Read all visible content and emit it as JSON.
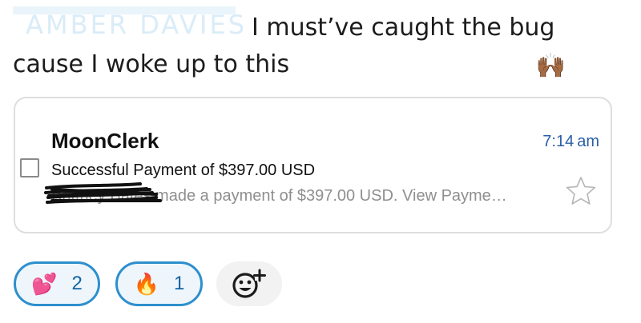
{
  "message": {
    "author_name": "AMBER DAVIES",
    "text": "I must’ve caught the bug cause I woke up to this",
    "emoji": "🙌🏾"
  },
  "email": {
    "sender": "MoonClerk",
    "time": "7:14 am",
    "subject": "Successful Payment of $397.00 USD",
    "preview": "Brittney Bates made a payment of $397.00 USD. View Payme…",
    "starred": false
  },
  "reactions": [
    {
      "emoji": "💕",
      "icon": "two-hearts-icon",
      "count": "2"
    },
    {
      "emoji": "🔥",
      "icon": "fire-icon",
      "count": "1"
    }
  ],
  "colors": {
    "reaction_border": "#2d8fcd",
    "reaction_bg": "#eef6fc",
    "reaction_count": "#1264a3",
    "time_text": "#2a5ea8"
  }
}
